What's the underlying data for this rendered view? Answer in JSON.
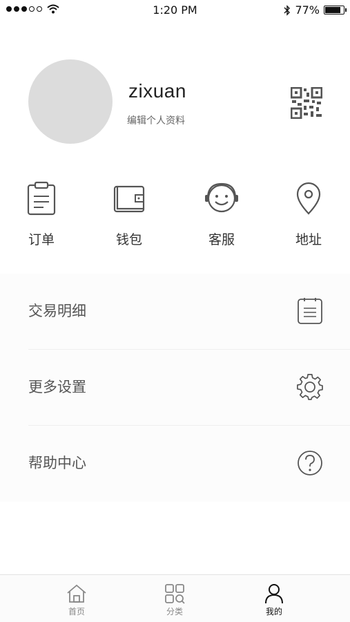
{
  "status_bar": {
    "signal_dots": [
      true,
      true,
      true,
      false,
      false
    ],
    "time": "1:20 PM",
    "battery_percent_text": "77%",
    "battery_level": 0.77
  },
  "profile": {
    "username": "zixuan",
    "edit_label": "编辑个人资料",
    "avatar_color": "#dcdcdc"
  },
  "actions": [
    {
      "label": "订单",
      "icon": "clipboard-icon"
    },
    {
      "label": "钱包",
      "icon": "wallet-icon"
    },
    {
      "label": "客服",
      "icon": "headset-smile-icon"
    },
    {
      "label": "地址",
      "icon": "location-pin-icon"
    }
  ],
  "menu": [
    {
      "label": "交易明细",
      "icon": "list-document-icon"
    },
    {
      "label": "更多设置",
      "icon": "gear-icon"
    },
    {
      "label": "帮助中心",
      "icon": "question-circle-icon"
    }
  ],
  "tabbar": {
    "tabs": [
      {
        "label": "首页",
        "icon": "home-icon",
        "active": false
      },
      {
        "label": "分类",
        "icon": "grid-search-icon",
        "active": false
      },
      {
        "label": "我的",
        "icon": "person-icon",
        "active": true
      }
    ]
  },
  "colors": {
    "icon_stroke": "#555555",
    "active_tab": "#111111",
    "inactive_tab": "#888888"
  }
}
